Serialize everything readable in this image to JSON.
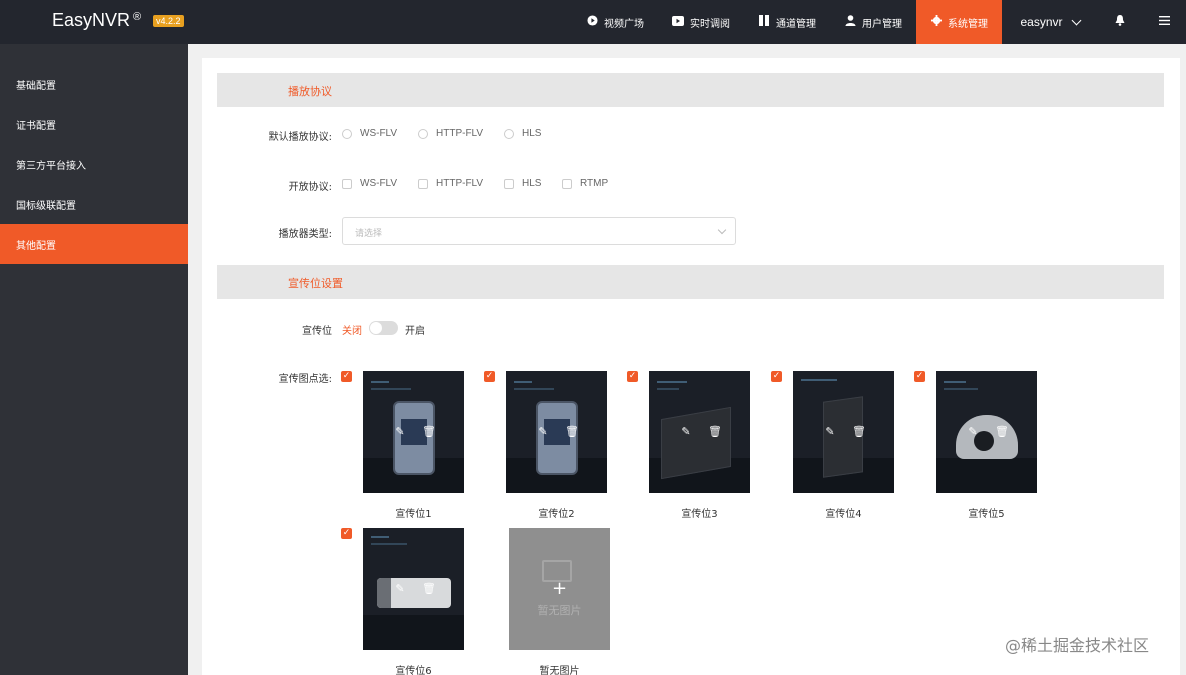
{
  "app": {
    "name": "EasyNVR",
    "mark": "®",
    "version": "v4.2.2"
  },
  "nav": {
    "items": [
      {
        "label": "视频广场",
        "icon": "play-circle-icon"
      },
      {
        "label": "实时调阅",
        "icon": "video-icon"
      },
      {
        "label": "通道管理",
        "icon": "channel-icon"
      },
      {
        "label": "用户管理",
        "icon": "user-icon"
      },
      {
        "label": "系统管理",
        "icon": "gear-icon"
      }
    ],
    "user": "easynvr"
  },
  "sidebar": {
    "items": [
      {
        "label": "基础配置"
      },
      {
        "label": "证书配置"
      },
      {
        "label": "第三方平台接入"
      },
      {
        "label": "国标级联配置"
      },
      {
        "label": "其他配置"
      }
    ],
    "active_index": 4
  },
  "playback": {
    "title": "播放协议",
    "default_label": "默认播放协议:",
    "default_options": [
      "WS-FLV",
      "HTTP-FLV",
      "HLS"
    ],
    "open_label": "开放协议:",
    "open_options": [
      "WS-FLV",
      "HTTP-FLV",
      "HLS",
      "RTMP"
    ],
    "player_label": "播放器类型:",
    "player_placeholder": "请选择"
  },
  "ads": {
    "title": "宣传位设置",
    "switch_label": "宣传位",
    "state_off": "关闭",
    "state_on": "开启",
    "enabled": false,
    "pick_label": "宣传图点选:",
    "items": [
      {
        "label": "宣传位1",
        "checked": true
      },
      {
        "label": "宣传位2",
        "checked": true
      },
      {
        "label": "宣传位3",
        "checked": true
      },
      {
        "label": "宣传位4",
        "checked": true
      },
      {
        "label": "宣传位5",
        "checked": true
      },
      {
        "label": "宣传位6",
        "checked": true
      }
    ],
    "empty": {
      "text": "暂无图片",
      "label": "暂无图片"
    }
  },
  "watermark": "@稀土掘金技术社区"
}
